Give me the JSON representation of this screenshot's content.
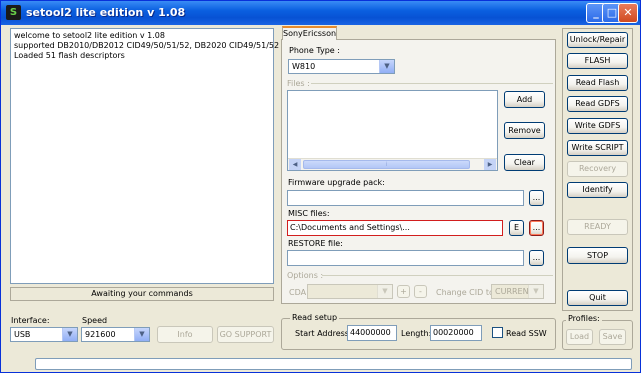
{
  "window": {
    "title": "setool2 lite edition v 1.08",
    "minimize": "_",
    "maximize": "□",
    "close": "✕",
    "app_icon": "S"
  },
  "log": {
    "lines": [
      "welcome to setool2 lite edition v 1.08",
      "supported DB2010/DB2012 CID49/50/51/52, DB2020 CID49/51/52",
      "Loaded 51 flash descriptors"
    ]
  },
  "status_text": "Awaiting your commands",
  "bottom_left": {
    "interface_label": "Interface:",
    "interface_value": "USB",
    "speed_label": "Speed",
    "speed_value": "921600",
    "info_button": "Info",
    "go_support_button": "GO SUPPORT"
  },
  "tab": {
    "label": "SonyEricsson"
  },
  "phone": {
    "phone_type_label": "Phone Type :",
    "phone_type_value": "W810",
    "files_label": "Files :",
    "add_button": "Add",
    "remove_button": "Remove",
    "clear_button": "Clear",
    "firmware_label": "Firmware upgrade pack:",
    "firmware_value": "",
    "firmware_browse": "...",
    "misc_label": "MISC files:",
    "misc_value": "C:\\Documents and Settings\\...",
    "misc_e_button": "E",
    "misc_browse": "...",
    "restore_label": "RESTORE file:",
    "restore_value": "",
    "restore_browse": "...",
    "options_label": "Options :",
    "cda_label": "CDA",
    "cda_value": "",
    "plus_button": "+",
    "minus_button": "-",
    "change_cid_label": "Change CID to",
    "change_cid_value": "CURRENT"
  },
  "read_setup": {
    "title": "Read setup",
    "start_label": "Start Address:",
    "start_value": "44000000",
    "length_label": "Length:",
    "length_value": "00020000",
    "read_ssw_label": "Read SSW"
  },
  "right_buttons": {
    "unlock_repair": "Unlock/Repair",
    "flash": "FLASH",
    "read_flash": "Read Flash",
    "read_gdfs": "Read GDFS",
    "write_gdfs": "Write GDFS",
    "write_script": "Write SCRIPT",
    "recovery": "Recovery",
    "identify": "Identify",
    "ready": "READY",
    "stop": "STOP",
    "quit": "Quit"
  },
  "profiles": {
    "label": "Profiles:",
    "load": "Load",
    "save": "Save"
  },
  "scrollbar": {
    "left": "◀",
    "right": "▶",
    "thumb": "⁞"
  }
}
